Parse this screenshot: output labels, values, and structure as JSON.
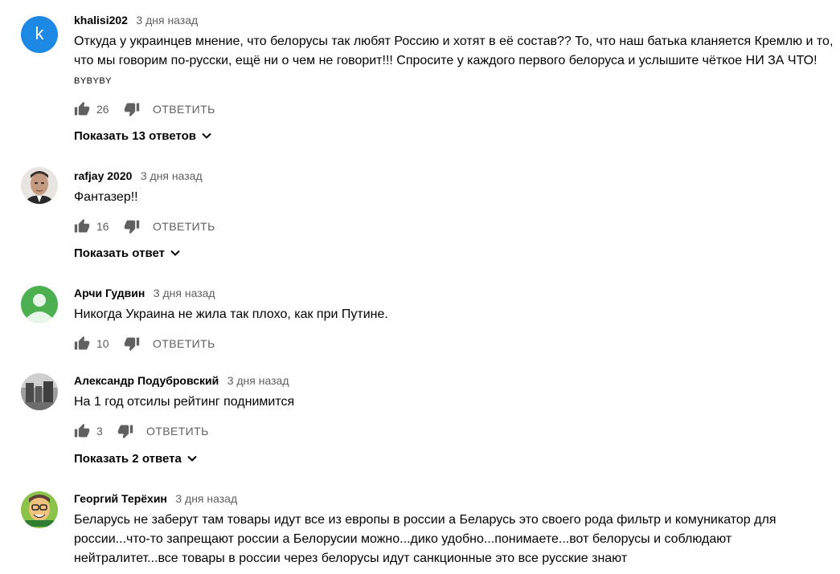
{
  "comments": [
    {
      "author": "khalisi202",
      "time": "3 дня назад",
      "avatar_letter": "k",
      "avatar_color": "#1e88e5",
      "text": "Откуда у украинцев мнение, что белорусы так любят Россию и хотят в её состав?? То, что наш батька кланяется Кремлю и то, что мы говорим по-русски, ещё ни о чем не говорит!!! Спросите у каждого первого белоруса и услышите чёткое НИ ЗА ЧТО!",
      "text_small": "BYBYBY",
      "likes": "26",
      "reply_label": "ОТВЕТИТЬ",
      "replies_label": "Показать 13 ответов"
    },
    {
      "author": "rafjay 2020",
      "time": "3 дня назад",
      "text": "Фантазер!!",
      "likes": "16",
      "reply_label": "ОТВЕТИТЬ",
      "replies_label": "Показать ответ"
    },
    {
      "author": "Арчи Гудвин",
      "time": "3 дня назад",
      "avatar_color": "#4caf50",
      "text": "Никогда Украина не жила так плохо, как при Путине.",
      "likes": "10",
      "reply_label": "ОТВЕТИТЬ"
    },
    {
      "author": "Александр Подубровский",
      "time": "3 дня назад",
      "text": "На 1 год отсилы рейтинг поднимится",
      "likes": "3",
      "reply_label": "ОТВЕТИТЬ",
      "replies_label": "Показать 2 ответа"
    },
    {
      "author": "Георгий Терёхин",
      "time": "3 дня назад",
      "text": "Беларусь не заберут там товары идут все из европы в россии а Беларусь это своего рода фильтр и комуникатор для россии...что-то запрещают россии а Белорусии можно...дико удобно...понимаете...вот белорусы и соблюдают нейтралитет...все товары в россии через белорусы идут санкционные это все русские знают"
    }
  ]
}
